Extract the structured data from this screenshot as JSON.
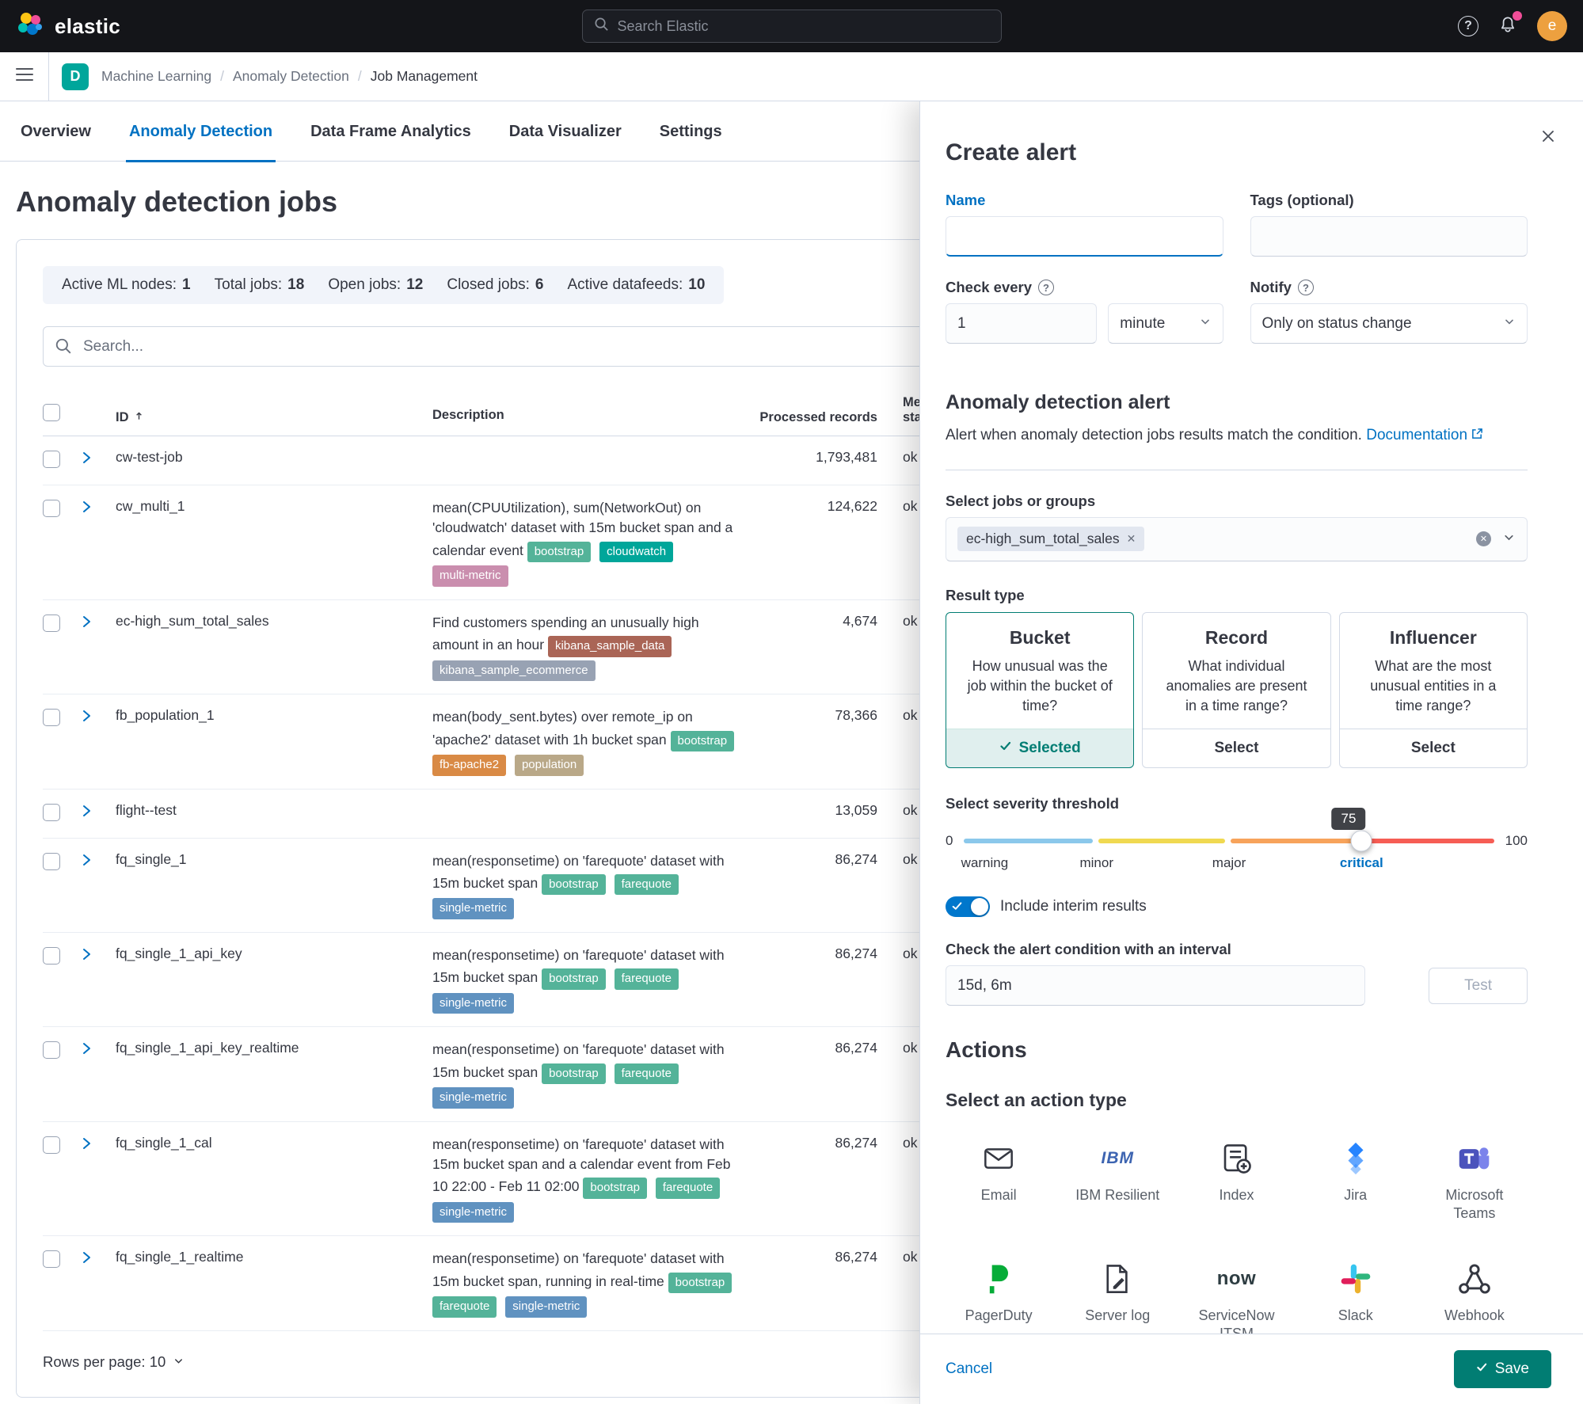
{
  "topbar": {
    "brand": "elastic",
    "search_placeholder": "Search Elastic",
    "avatar_initial": "e"
  },
  "breadcrumbs": {
    "space_initial": "D",
    "items": [
      "Machine Learning",
      "Anomaly Detection",
      "Job Management"
    ]
  },
  "tabs": [
    {
      "label": "Overview"
    },
    {
      "label": "Anomaly Detection"
    },
    {
      "label": "Data Frame Analytics"
    },
    {
      "label": "Data Visualizer"
    },
    {
      "label": "Settings"
    }
  ],
  "page": {
    "title": "Anomaly detection jobs",
    "stats": [
      {
        "label": "Active ML nodes:",
        "value": "1"
      },
      {
        "label": "Total jobs:",
        "value": "18"
      },
      {
        "label": "Open jobs:",
        "value": "12"
      },
      {
        "label": "Closed jobs:",
        "value": "6"
      },
      {
        "label": "Active datafeeds:",
        "value": "10"
      }
    ],
    "search_placeholder": "Search...",
    "pagination_label": "Rows per page: 10"
  },
  "table": {
    "headers": {
      "id": "ID",
      "description": "Description",
      "records": "Processed records",
      "memory": "Memory status"
    },
    "rows": [
      {
        "id": "cw-test-job",
        "desc": "",
        "records": "1,793,481",
        "memory": "ok",
        "tags": []
      },
      {
        "id": "cw_multi_1",
        "desc": "mean(CPUUtilization), sum(NetworkOut) on 'cloudwatch' dataset with 15m bucket span and a calendar event",
        "records": "124,622",
        "memory": "ok",
        "tags": [
          {
            "label": "bootstrap",
            "color": "#54b399"
          },
          {
            "label": "cloudwatch",
            "color": "#00a69a"
          },
          {
            "label": "multi-metric",
            "color": "#ca8eae"
          }
        ]
      },
      {
        "id": "ec-high_sum_total_sales",
        "desc": "Find customers spending an unusually high amount in an hour",
        "records": "4,674",
        "memory": "ok",
        "tags": [
          {
            "label": "kibana_sample_data",
            "color": "#aa6556"
          },
          {
            "label": "kibana_sample_ecommerce",
            "color": "#98a2b3"
          }
        ]
      },
      {
        "id": "fb_population_1",
        "desc": "mean(body_sent.bytes) over remote_ip on 'apache2' dataset with 1h bucket span",
        "records": "78,366",
        "memory": "ok",
        "tags": [
          {
            "label": "bootstrap",
            "color": "#54b399"
          },
          {
            "label": "fb-apache2",
            "color": "#d98a45"
          },
          {
            "label": "population",
            "color": "#b9a888"
          }
        ]
      },
      {
        "id": "flight--test",
        "desc": "",
        "records": "13,059",
        "memory": "ok",
        "tags": []
      },
      {
        "id": "fq_single_1",
        "desc": "mean(responsetime) on 'farequote' dataset with 15m bucket span",
        "records": "86,274",
        "memory": "ok",
        "tags": [
          {
            "label": "bootstrap",
            "color": "#54b399"
          },
          {
            "label": "farequote",
            "color": "#54b399"
          },
          {
            "label": "single-metric",
            "color": "#6092c0"
          }
        ]
      },
      {
        "id": "fq_single_1_api_key",
        "desc": "mean(responsetime) on 'farequote' dataset with 15m bucket span",
        "records": "86,274",
        "memory": "ok",
        "tags": [
          {
            "label": "bootstrap",
            "color": "#54b399"
          },
          {
            "label": "farequote",
            "color": "#54b399"
          },
          {
            "label": "single-metric",
            "color": "#6092c0"
          }
        ]
      },
      {
        "id": "fq_single_1_api_key_realtime",
        "desc": "mean(responsetime) on 'farequote' dataset with 15m bucket span",
        "records": "86,274",
        "memory": "ok",
        "tags": [
          {
            "label": "bootstrap",
            "color": "#54b399"
          },
          {
            "label": "farequote",
            "color": "#54b399"
          },
          {
            "label": "single-metric",
            "color": "#6092c0"
          }
        ]
      },
      {
        "id": "fq_single_1_cal",
        "desc": "mean(responsetime) on 'farequote' dataset with 15m bucket span and a calendar event from Feb 10 22:00 - Feb 11 02:00",
        "records": "86,274",
        "memory": "ok",
        "tags": [
          {
            "label": "bootstrap",
            "color": "#54b399"
          },
          {
            "label": "farequote",
            "color": "#54b399"
          },
          {
            "label": "single-metric",
            "color": "#6092c0"
          }
        ]
      },
      {
        "id": "fq_single_1_realtime",
        "desc": "mean(responsetime) on 'farequote' dataset with 15m bucket span, running in real-time",
        "records": "86,274",
        "memory": "ok",
        "tags": [
          {
            "label": "bootstrap",
            "color": "#54b399"
          },
          {
            "label": "farequote",
            "color": "#54b399"
          },
          {
            "label": "single-metric",
            "color": "#6092c0"
          }
        ]
      }
    ]
  },
  "flyout": {
    "title": "Create alert",
    "name_label": "Name",
    "tags_label": "Tags (optional)",
    "check_every_label": "Check every",
    "check_every_value": "1",
    "check_every_unit": "minute",
    "notify_label": "Notify",
    "notify_value": "Only on status change",
    "section_title": "Anomaly detection alert",
    "section_desc": "Alert when anomaly detection jobs results match the condition.",
    "doc_link": "Documentation",
    "jobs_label": "Select jobs or groups",
    "jobs_chip": "ec-high_sum_total_sales",
    "result_type_label": "Result type",
    "result_types": [
      {
        "title": "Bucket",
        "desc": "How unusual was the job within the bucket of time?",
        "action": "Selected"
      },
      {
        "title": "Record",
        "desc": "What individual anomalies are present in a time range?",
        "action": "Select"
      },
      {
        "title": "Influencer",
        "desc": "What are the most unusual entities in a time range?",
        "action": "Select"
      }
    ],
    "severity": {
      "label": "Select severity threshold",
      "min": "0",
      "max": "100",
      "value": "75",
      "ticks": [
        {
          "label": "warning",
          "color": "#8bc8eb"
        },
        {
          "label": "minor",
          "color": "#f0d951"
        },
        {
          "label": "major",
          "color": "#f7a35b"
        },
        {
          "label": "critical",
          "color": "#f65d54"
        }
      ]
    },
    "interim_label": "Include interim results",
    "interval_label": "Check the alert condition with an interval",
    "interval_value": "15d, 6m",
    "test_label": "Test",
    "actions_title": "Actions",
    "action_type_title": "Select an action type",
    "connectors": [
      {
        "label": "Email"
      },
      {
        "label": "IBM Resilient"
      },
      {
        "label": "Index"
      },
      {
        "label": "Jira"
      },
      {
        "label": "Microsoft Teams"
      },
      {
        "label": "PagerDuty"
      },
      {
        "label": "Server log"
      },
      {
        "label": "ServiceNow ITSM"
      },
      {
        "label": "Slack"
      },
      {
        "label": "Webhook"
      }
    ],
    "cancel_label": "Cancel",
    "save_label": "Save"
  }
}
